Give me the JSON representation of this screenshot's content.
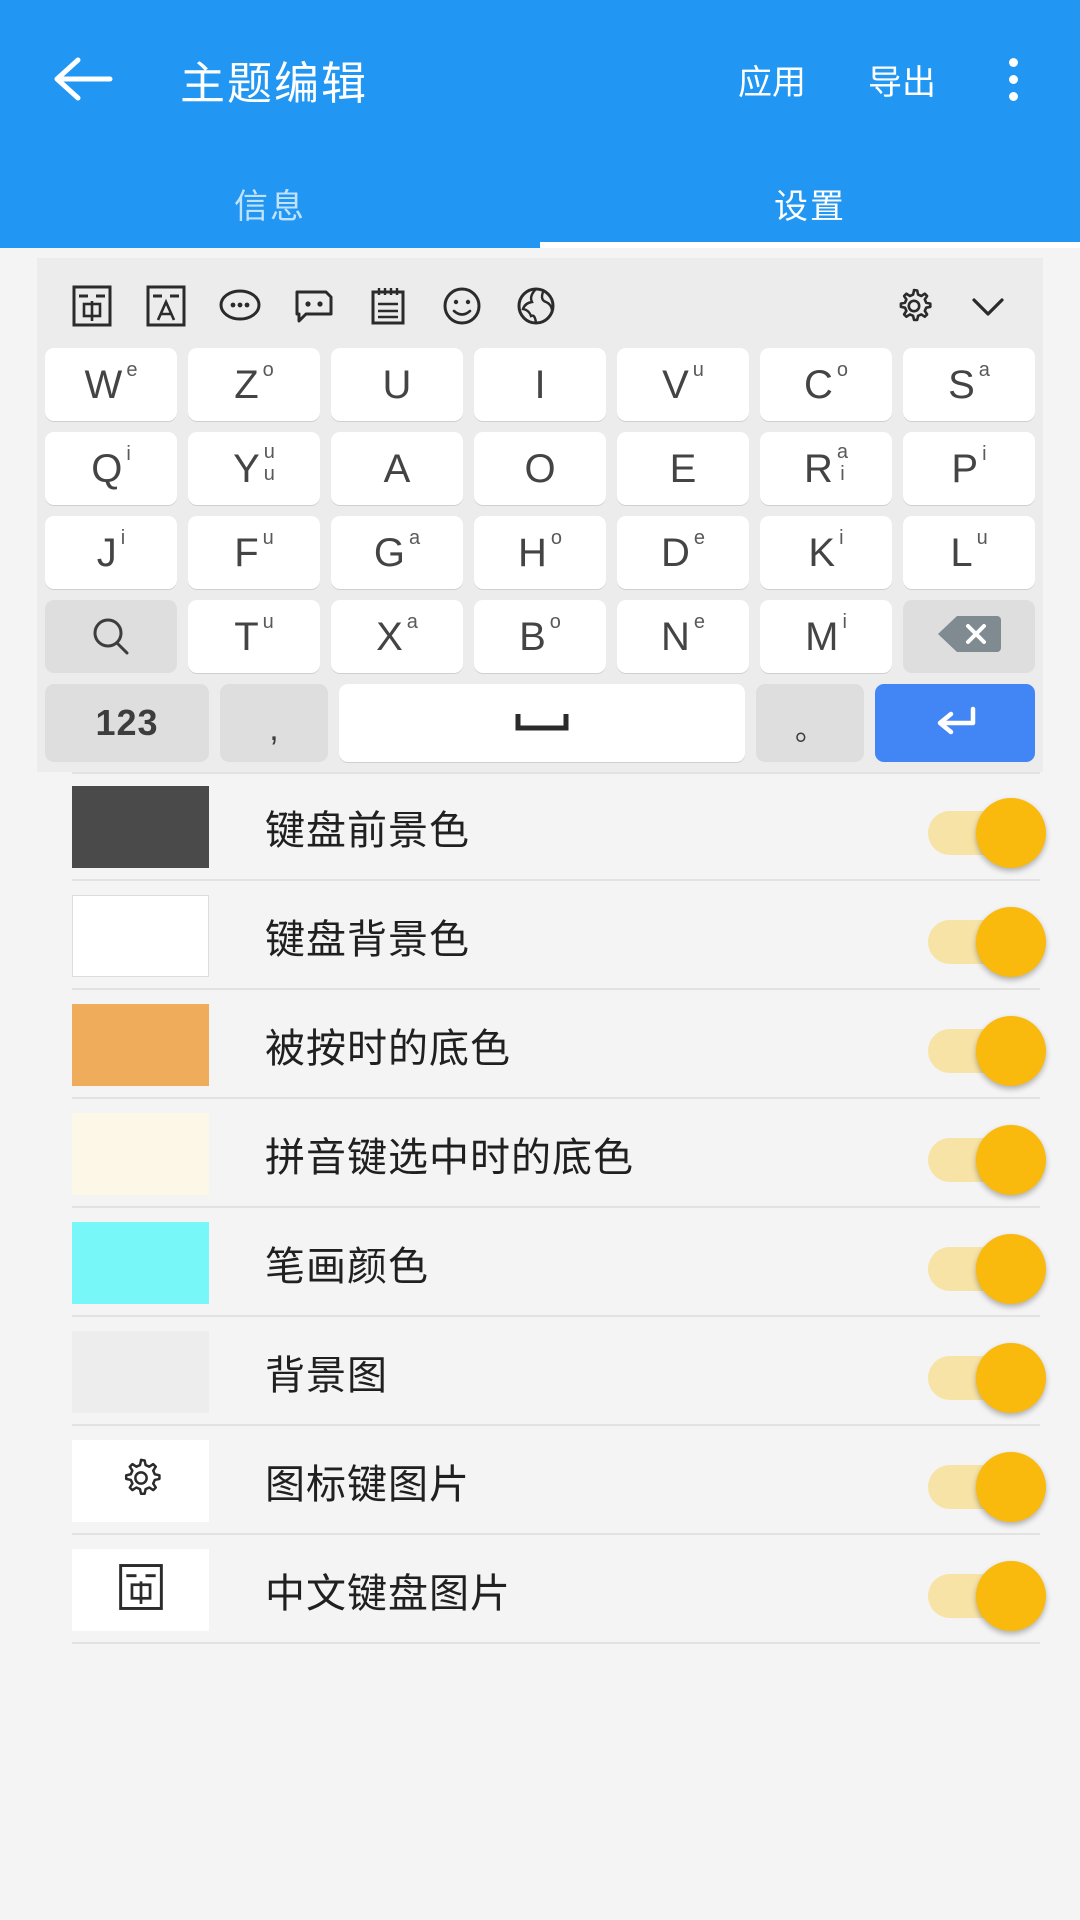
{
  "header": {
    "title": "主题编辑",
    "back_icon": "arrow-left-icon",
    "apply_label": "应用",
    "export_label": "导出",
    "overflow_icon": "more-vertical-icon",
    "background_color": "#2196f3"
  },
  "tabs": [
    {
      "label": "信息",
      "active": false
    },
    {
      "label": "设置",
      "active": true
    }
  ],
  "keyboard": {
    "toolbar_icons": [
      "chinese-input-icon",
      "latin-input-icon",
      "speech-bubble-dots-icon",
      "chat-bubble-icon",
      "notepad-icon",
      "smiley-icon",
      "globe-icon"
    ],
    "toolbar_right_icons": [
      "gear-icon",
      "chevron-down-icon"
    ],
    "rows": [
      [
        {
          "main": "W",
          "sup": [
            "e"
          ]
        },
        {
          "main": "Z",
          "sup": [
            "o"
          ]
        },
        {
          "main": "U",
          "sup": []
        },
        {
          "main": "I",
          "sup": []
        },
        {
          "main": "V",
          "sup": [
            "u"
          ]
        },
        {
          "main": "C",
          "sup": [
            "o"
          ]
        },
        {
          "main": "S",
          "sup": [
            "a"
          ]
        }
      ],
      [
        {
          "main": "Q",
          "sup": [
            "i"
          ]
        },
        {
          "main": "Y",
          "sup": [
            "u",
            "u"
          ]
        },
        {
          "main": "A",
          "sup": []
        },
        {
          "main": "O",
          "sup": []
        },
        {
          "main": "E",
          "sup": []
        },
        {
          "main": "R",
          "sup": [
            "a",
            "i"
          ]
        },
        {
          "main": "P",
          "sup": [
            "i"
          ]
        }
      ],
      [
        {
          "main": "J",
          "sup": [
            "i"
          ]
        },
        {
          "main": "F",
          "sup": [
            "u"
          ]
        },
        {
          "main": "G",
          "sup": [
            "a"
          ]
        },
        {
          "main": "H",
          "sup": [
            "o"
          ]
        },
        {
          "main": "D",
          "sup": [
            "e"
          ]
        },
        {
          "main": "K",
          "sup": [
            "i"
          ]
        },
        {
          "main": "L",
          "sup": [
            "u"
          ]
        }
      ],
      [
        {
          "main": "",
          "sup": [],
          "icon": "search-icon"
        },
        {
          "main": "T",
          "sup": [
            "u"
          ]
        },
        {
          "main": "X",
          "sup": [
            "a"
          ]
        },
        {
          "main": "B",
          "sup": [
            "o"
          ]
        },
        {
          "main": "N",
          "sup": [
            "e"
          ]
        },
        {
          "main": "M",
          "sup": [
            "i"
          ]
        },
        {
          "main": "",
          "sup": [],
          "icon": "backspace-icon"
        }
      ]
    ],
    "bottom_row": {
      "numeric_label": "123",
      "comma_label": ",",
      "space_icon": "space-bar-icon",
      "period_label": "。",
      "enter_icon": "enter-arrow-icon"
    }
  },
  "settings": {
    "rows": [
      {
        "label": "键盘前景色",
        "swatch_color": "#4a4a4a",
        "swatch_type": "color",
        "toggle_on": true
      },
      {
        "label": "键盘背景色",
        "swatch_color": "#ffffff",
        "swatch_type": "color",
        "toggle_on": true
      },
      {
        "label": "被按时的底色",
        "swatch_color": "#efad5b",
        "swatch_type": "color",
        "toggle_on": true
      },
      {
        "label": "拼音键选中时的底色",
        "swatch_color": "#fdf7e8",
        "swatch_type": "color",
        "toggle_on": true
      },
      {
        "label": "笔画颜色",
        "swatch_color": "#77f7f7",
        "swatch_type": "color",
        "toggle_on": true
      },
      {
        "label": "背景图",
        "swatch_color": "#ededed",
        "swatch_type": "image",
        "toggle_on": true
      },
      {
        "label": "图标键图片",
        "swatch_color": "#ffffff",
        "swatch_type": "icon",
        "swatch_icon": "gear-icon",
        "toggle_on": true
      },
      {
        "label": "中文键盘图片",
        "swatch_color": "#ffffff",
        "swatch_type": "icon",
        "swatch_icon": "chinese-input-icon",
        "toggle_on": true
      }
    ],
    "toggle_track_color": "#f7e3a6",
    "toggle_thumb_color": "#f9b90d"
  }
}
